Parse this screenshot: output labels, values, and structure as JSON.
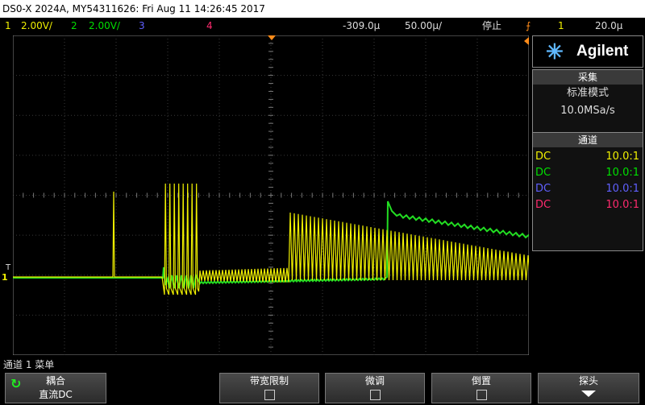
{
  "title": "DS0-X 2024A, MY54311626: Fri Aug 11 14:26:45 2017",
  "status": {
    "ch1_num": "1",
    "ch1_scale": "2.00V/",
    "ch2_num": "2",
    "ch2_scale": "2.00V/",
    "ch3_num": "3",
    "ch4_num": "4",
    "time_offset": "-309.0µ",
    "timebase": "50.00µ/",
    "run_state": "停止",
    "trigger_channel": "1",
    "trigger_level": "20.0μ"
  },
  "logo": {
    "brand": "Agilent",
    "icon": "agilent-spark-icon"
  },
  "acquisition": {
    "header": "采集",
    "mode": "标准模式",
    "sample_rate": "10.0MSa/s"
  },
  "channels_panel": {
    "header": "通道",
    "rows": [
      {
        "coupling": "DC",
        "probe": "10.0:1",
        "color": "#f0f000"
      },
      {
        "coupling": "DC",
        "probe": "10.0:1",
        "color": "#00e000"
      },
      {
        "coupling": "DC",
        "probe": "10.0:1",
        "color": "#6060ff"
      },
      {
        "coupling": "DC",
        "probe": "10.0:1",
        "color": "#ff2a6e"
      }
    ]
  },
  "markers": {
    "trigger_marker": "T",
    "ch1_ground": "1"
  },
  "menu_title": "通道 1 菜单",
  "softkeys": {
    "coupling_label": "耦合",
    "coupling_value": "直流DC",
    "bw_limit_label": "带宽限制",
    "fine_label": "微调",
    "invert_label": "倒置",
    "probe_label": "探头"
  },
  "colors": {
    "ch1": "#f0f000",
    "ch2": "#00e000",
    "ch3": "#6060ff",
    "ch4": "#ff2a6e",
    "accent": "#ff8c1a"
  }
}
